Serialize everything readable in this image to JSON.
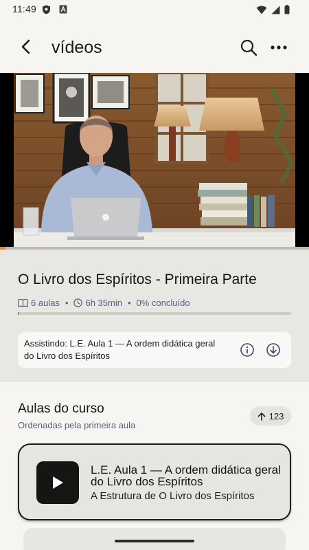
{
  "status": {
    "time": "11:49"
  },
  "appbar": {
    "title": "vídeos"
  },
  "course": {
    "title": "O Livro dos Espíritos - Primeira Parte",
    "lessons_count": "6 aulas",
    "duration": "6h 35min",
    "completion": "0% concluído",
    "progress": 0,
    "watching_text": "Assistindo: L.E. Aula 1 — A ordem didática geral do Livro dos Espíritos"
  },
  "lessons_section": {
    "title": "Aulas do curso",
    "subtitle": "Ordenadas pela primeira aula",
    "sort_count": "123"
  },
  "current_lesson": {
    "title": "L.E. Aula 1 — A ordem didática geral do Livro dos Espíritos",
    "subtitle": "A Estrutura de O Livro dos Espíritos"
  },
  "colors": {
    "accent": "#e8862e",
    "meta_text": "#56617a",
    "panel": "#e8e7e3"
  }
}
